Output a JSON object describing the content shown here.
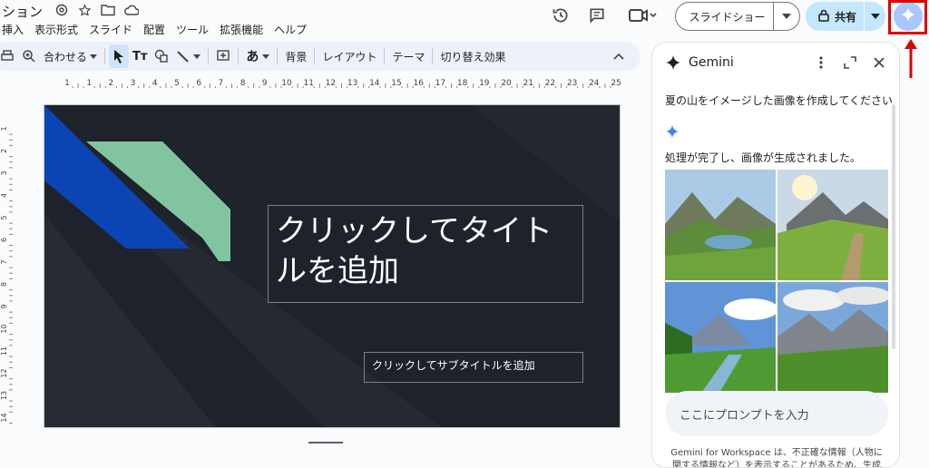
{
  "header": {
    "doc_title": "ション",
    "menus": [
      "挿入",
      "表示形式",
      "スライド",
      "配置",
      "ツール",
      "拡張機能",
      "ヘルプ"
    ],
    "slideshow_label": "スライドショー",
    "share_label": "共有"
  },
  "toolbar": {
    "zoom_label": "合わせる",
    "text_tool_label": "Tт",
    "font_label": "あ",
    "background_label": "背景",
    "layout_label": "レイアウト",
    "theme_label": "テーマ",
    "transition_label": "切り替え効果"
  },
  "ruler": {
    "h_ticks": [
      "1",
      "1",
      "2",
      "3",
      "4",
      "5",
      "6",
      "7",
      "8",
      "9",
      "10",
      "11",
      "12",
      "13",
      "14",
      "15",
      "16",
      "17",
      "18",
      "19",
      "20",
      "21",
      "22",
      "23",
      "24",
      "25"
    ],
    "v_ticks": [
      "1",
      "2",
      "3",
      "4",
      "5",
      "6",
      "7",
      "8",
      "9",
      "10",
      "11",
      "12",
      "13",
      "14"
    ]
  },
  "slide": {
    "title_placeholder": "クリックしてタイトルを追加",
    "subtitle_placeholder": "クリックしてサブタイトルを追加"
  },
  "gemini": {
    "title": "Gemini",
    "user_prompt": "夏の山をイメージした画像を作成してください",
    "reply": "処理が完了し、画像が生成されました。",
    "input_placeholder": "ここにプロンプトを入力",
    "disclaimer": "Gemini for Workspace は、不正確な情報（人物に関する情報など）を表示することがあるため、生成"
  },
  "colors": {
    "accent_blue": "#0b57d0",
    "share_bg": "#c2e7ff",
    "highlight_red": "#e00000",
    "slide_bg": "#1e222b"
  }
}
